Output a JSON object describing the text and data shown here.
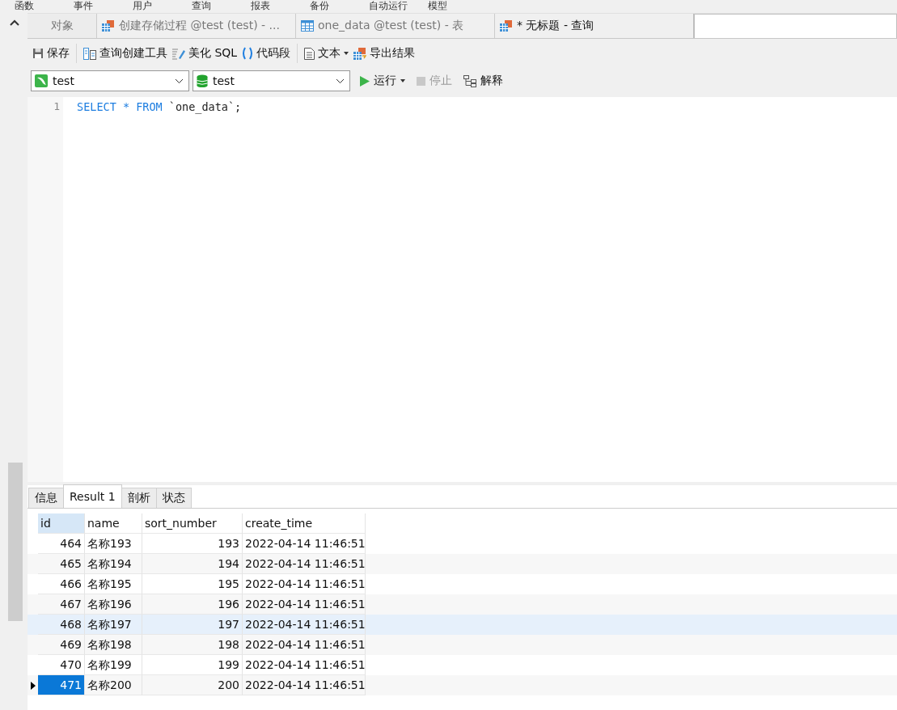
{
  "menu_bar": {
    "items": [
      "函数",
      "事件",
      "用户",
      "查询",
      "报表",
      "备份",
      "自动运行",
      "模型"
    ]
  },
  "tabs": [
    {
      "label": "对象",
      "selected": false,
      "kind": "plain"
    },
    {
      "label": "创建存储过程 @test (test) - ...",
      "selected": false,
      "kind": "proc"
    },
    {
      "label": "one_data @test (test) - 表",
      "selected": false,
      "kind": "table"
    },
    {
      "label": "* 无标题 - 查询",
      "selected": true,
      "kind": "proc"
    }
  ],
  "toolbar": [
    {
      "label": "保存",
      "kind": "save",
      "caret": false
    },
    {
      "label": "查询创建工具",
      "kind": "builder",
      "caret": false
    },
    {
      "label": "美化 SQL",
      "kind": "beautify",
      "caret": false
    },
    {
      "label": "代码段",
      "kind": "snippet",
      "caret": false
    },
    {
      "label": "文本",
      "kind": "text",
      "caret": true
    },
    {
      "label": "导出结果",
      "kind": "export",
      "caret": false
    }
  ],
  "connection": {
    "value": "test"
  },
  "database": {
    "value": "test"
  },
  "actions": [
    {
      "label": "运行",
      "kind": "run",
      "disabled": false,
      "caret": true
    },
    {
      "label": "停止",
      "kind": "stop",
      "disabled": true,
      "caret": false
    },
    {
      "label": "解释",
      "kind": "explain",
      "disabled": false,
      "caret": false
    }
  ],
  "editor": {
    "lines": [
      {
        "number": "1",
        "code": [
          {
            "text": "SELECT * FROM",
            "kind": "keyword"
          },
          {
            "text": " `one_data`;",
            "kind": "plain"
          }
        ]
      }
    ]
  },
  "result_tabs": [
    {
      "label": "信息",
      "selected": false
    },
    {
      "label": "Result 1",
      "selected": true
    },
    {
      "label": "剖析",
      "selected": false
    },
    {
      "label": "状态",
      "selected": false
    }
  ],
  "table": {
    "columns": [
      "id",
      "name",
      "sort_number",
      "create_time"
    ],
    "rows": [
      {
        "cells": [
          "464",
          "名称193",
          "193",
          "2022-04-14 11:46:51"
        ],
        "selected": false,
        "hovered": false
      },
      {
        "cells": [
          "465",
          "名称194",
          "194",
          "2022-04-14 11:46:51"
        ],
        "selected": false,
        "hovered": false
      },
      {
        "cells": [
          "466",
          "名称195",
          "195",
          "2022-04-14 11:46:51"
        ],
        "selected": false,
        "hovered": false
      },
      {
        "cells": [
          "467",
          "名称196",
          "196",
          "2022-04-14 11:46:51"
        ],
        "selected": false,
        "hovered": false
      },
      {
        "cells": [
          "468",
          "名称197",
          "197",
          "2022-04-14 11:46:51"
        ],
        "selected": false,
        "hovered": true
      },
      {
        "cells": [
          "469",
          "名称198",
          "198",
          "2022-04-14 11:46:51"
        ],
        "selected": false,
        "hovered": false
      },
      {
        "cells": [
          "470",
          "名称199",
          "199",
          "2022-04-14 11:46:51"
        ],
        "selected": false,
        "hovered": false
      },
      {
        "cells": [
          "471",
          "名称200",
          "200",
          "2022-04-14 11:46:51"
        ],
        "selected": true,
        "hovered": false
      }
    ]
  }
}
